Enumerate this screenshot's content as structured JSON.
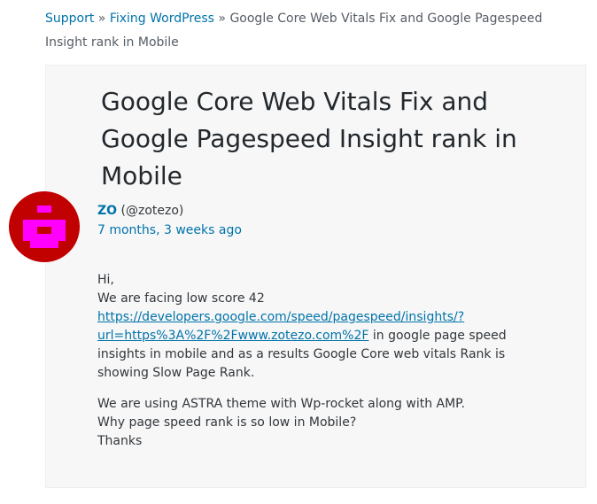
{
  "breadcrumb": {
    "items": [
      "Support",
      "Fixing WordPress"
    ],
    "separator": "»",
    "current": "Google Core Web Vitals Fix and Google Pagespeed Insight rank in Mobile"
  },
  "topic": {
    "title": "Google Core Web Vitals Fix and Google Pagespeed Insight rank in Mobile"
  },
  "author": {
    "avatar_icon": "identicon-avatar",
    "name": "ZO",
    "handle": "(@zotezo)",
    "date": "7 months, 3 weeks ago"
  },
  "post": {
    "greeting": "Hi,",
    "line1": "We are facing low score 42",
    "link_text": "https://developers.google.com/speed/pagespeed/insights/?url=https%3A%2F%2Fwww.zotezo.com%2F",
    "after_link": " in google page speed insights in mobile and as a results Google Core web vitals Rank is showing Slow Page Rank.",
    "p2_line1": "We are using ASTRA theme with Wp-rocket along with AMP.",
    "p2_line2": "Why page speed rank is so low in Mobile?",
    "p2_line3": "Thanks"
  },
  "colors": {
    "link": "#0073aa",
    "avatar_bg": "#c10000",
    "avatar_fg": "#ff00ff",
    "card_bg": "#f7f7f7"
  }
}
